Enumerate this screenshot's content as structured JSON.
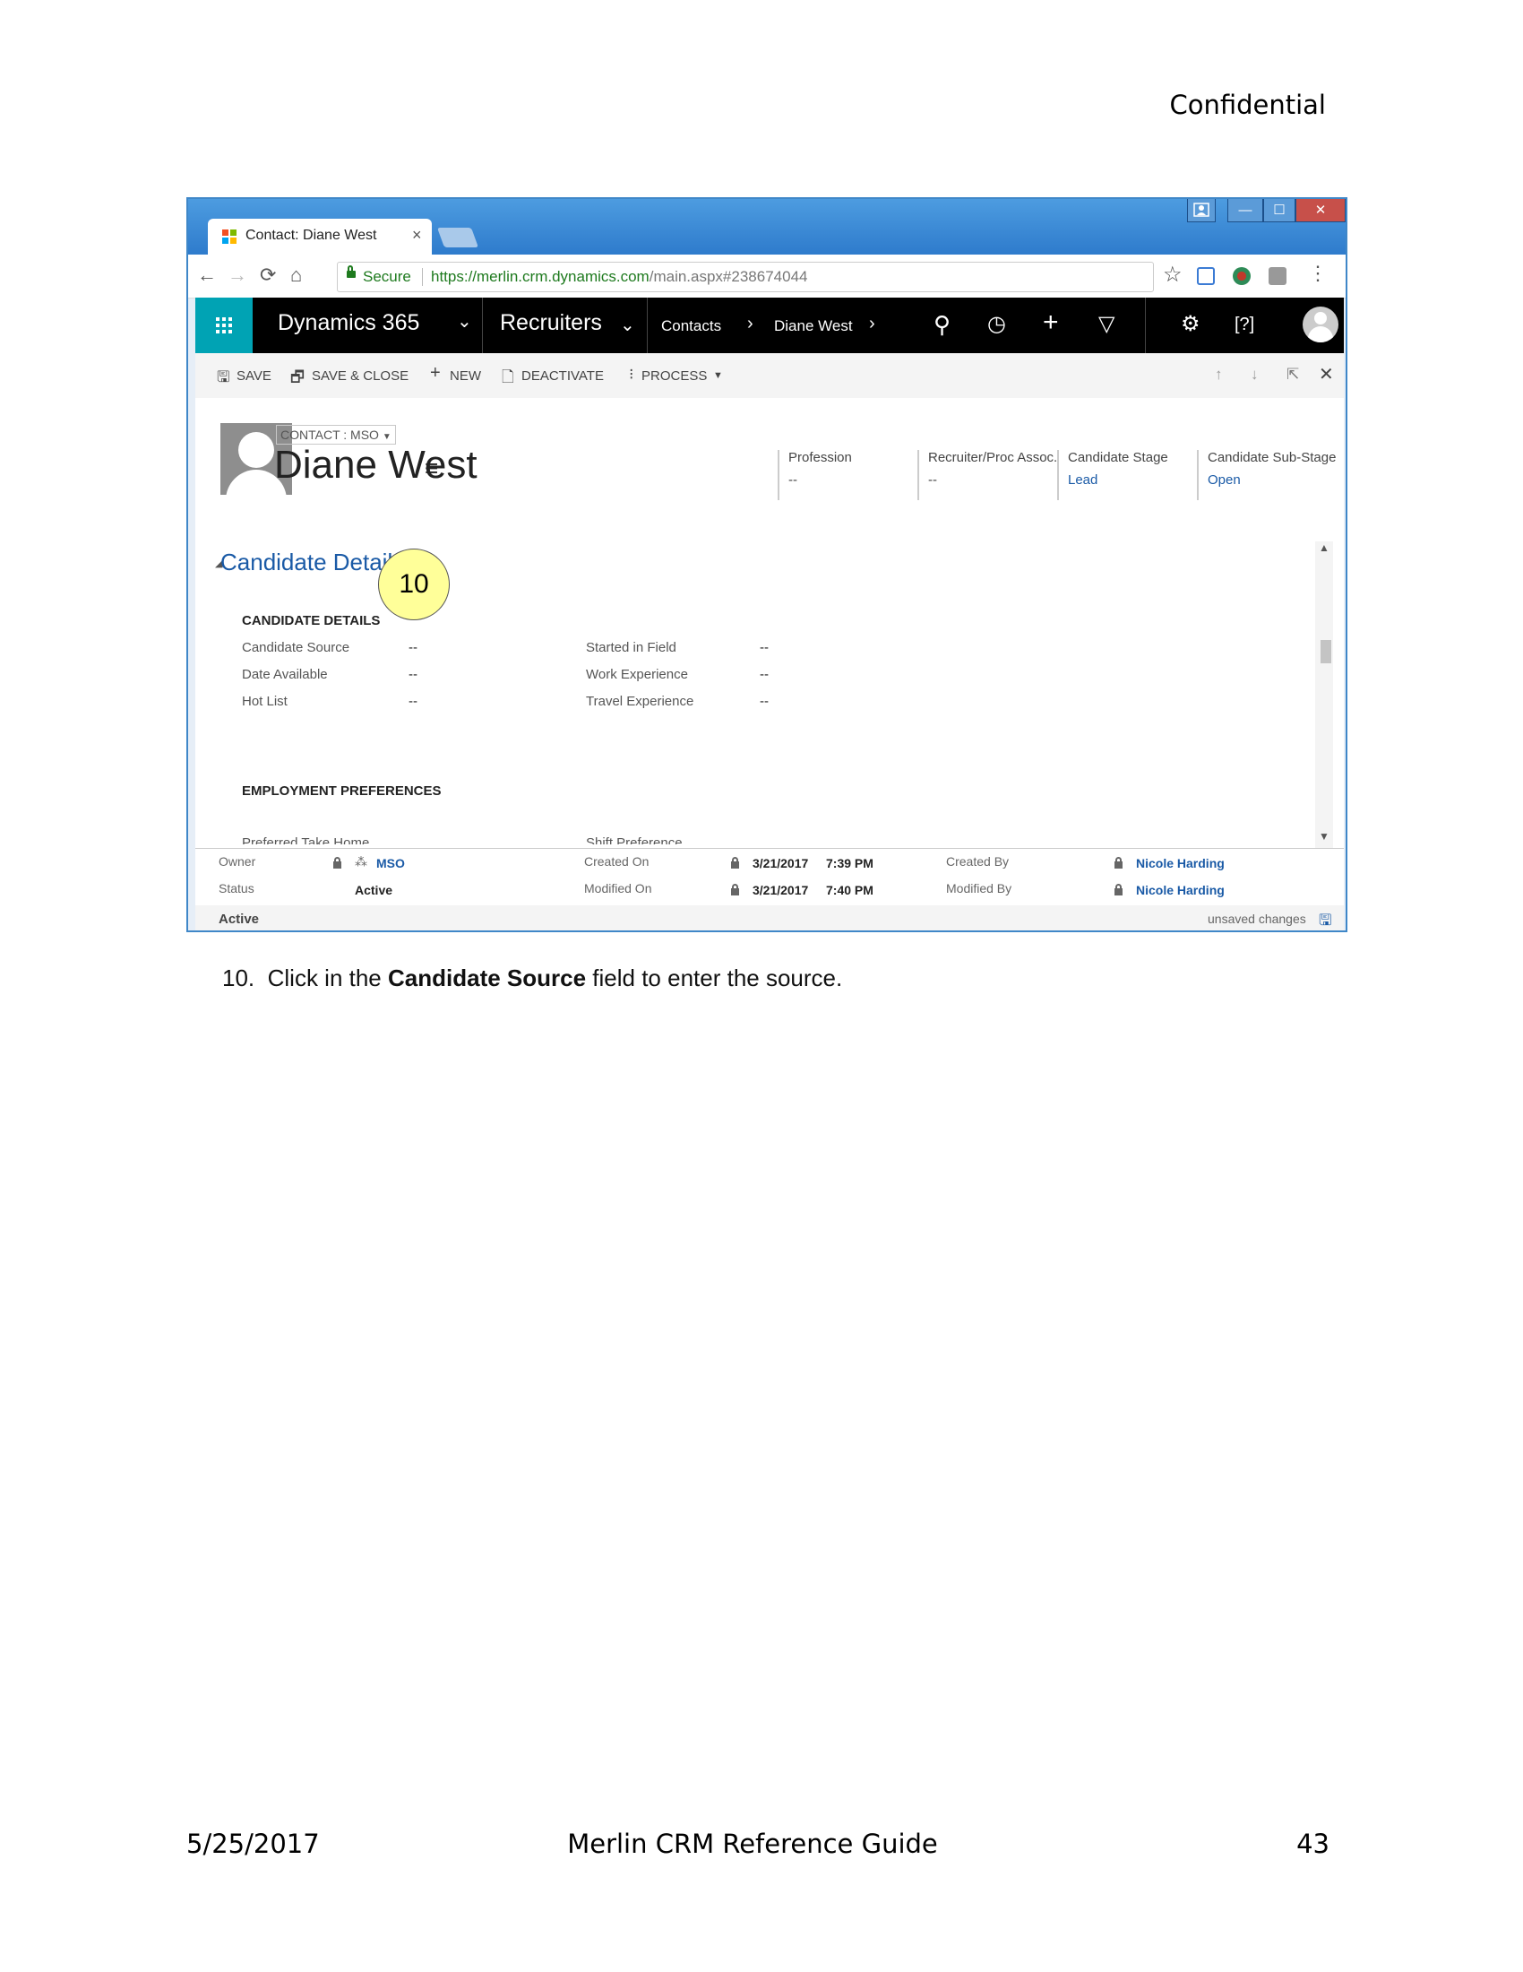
{
  "page": {
    "confidential": "Confidential",
    "footer_date": "5/25/2017",
    "footer_title": "Merlin CRM Reference Guide",
    "footer_page": "43",
    "instruction": {
      "number": "10.",
      "before": "Click in the ",
      "bold": "Candidate Source",
      "after": " field to enter the source."
    }
  },
  "browser": {
    "tab_title": "Contact: Diane West",
    "tab_close": "×",
    "secure_label": "Secure",
    "url_host": "https://merlin.crm.dynamics.com",
    "url_path": "/main.aspx#238674044",
    "window_buttons": {
      "minimize": "—",
      "maximize": "☐",
      "close": "✕"
    }
  },
  "crm": {
    "app_name": "Dynamics 365",
    "area": "Recruiters",
    "breadcrumb": [
      "Contacts",
      "Diane West"
    ],
    "commands": [
      "SAVE",
      "SAVE & CLOSE",
      "NEW",
      "DEACTIVATE",
      "PROCESS"
    ]
  },
  "record": {
    "entity_type": "CONTACT : MSO",
    "name": "Diane West",
    "header_fields": [
      {
        "label": "Profession",
        "value": "--"
      },
      {
        "label": "Recruiter/Proc Assoc.",
        "value": "--"
      },
      {
        "label": "Candidate Stage",
        "value": "Lead"
      },
      {
        "label": "Candidate Sub-Stage",
        "value": "Open"
      }
    ]
  },
  "section": {
    "title": "Candidate Details",
    "group_title": "CANDIDATE DETAILS",
    "left_fields": [
      {
        "label": "Candidate Source",
        "value": "--"
      },
      {
        "label": "Date Available",
        "value": "--"
      },
      {
        "label": "Hot List",
        "value": "--"
      }
    ],
    "right_fields": [
      {
        "label": "Started in Field",
        "value": "--"
      },
      {
        "label": "Work Experience",
        "value": "--"
      },
      {
        "label": "Travel Experience",
        "value": "--"
      }
    ],
    "group2_title": "EMPLOYMENT PREFERENCES",
    "cut_left": "Preferred Take Home",
    "cut_right": "Shift Preference"
  },
  "callout": "10",
  "footer_fields": {
    "owner_label": "Owner",
    "owner_value": "MSO",
    "status_label": "Status",
    "status_value": "Active",
    "created_on_label": "Created On",
    "created_on_date": "3/21/2017",
    "created_on_time": "7:39 PM",
    "modified_on_label": "Modified On",
    "modified_on_date": "3/21/2017",
    "modified_on_time": "7:40 PM",
    "created_by_label": "Created By",
    "created_by_value": "Nicole Harding",
    "modified_by_label": "Modified By",
    "modified_by_value": "Nicole Harding"
  },
  "statusbar": {
    "state": "Active",
    "unsaved": "unsaved changes"
  },
  "colors": {
    "crm_link": "#1a5aa6",
    "waffle": "#00a3b4",
    "callout": "#ffff99"
  }
}
